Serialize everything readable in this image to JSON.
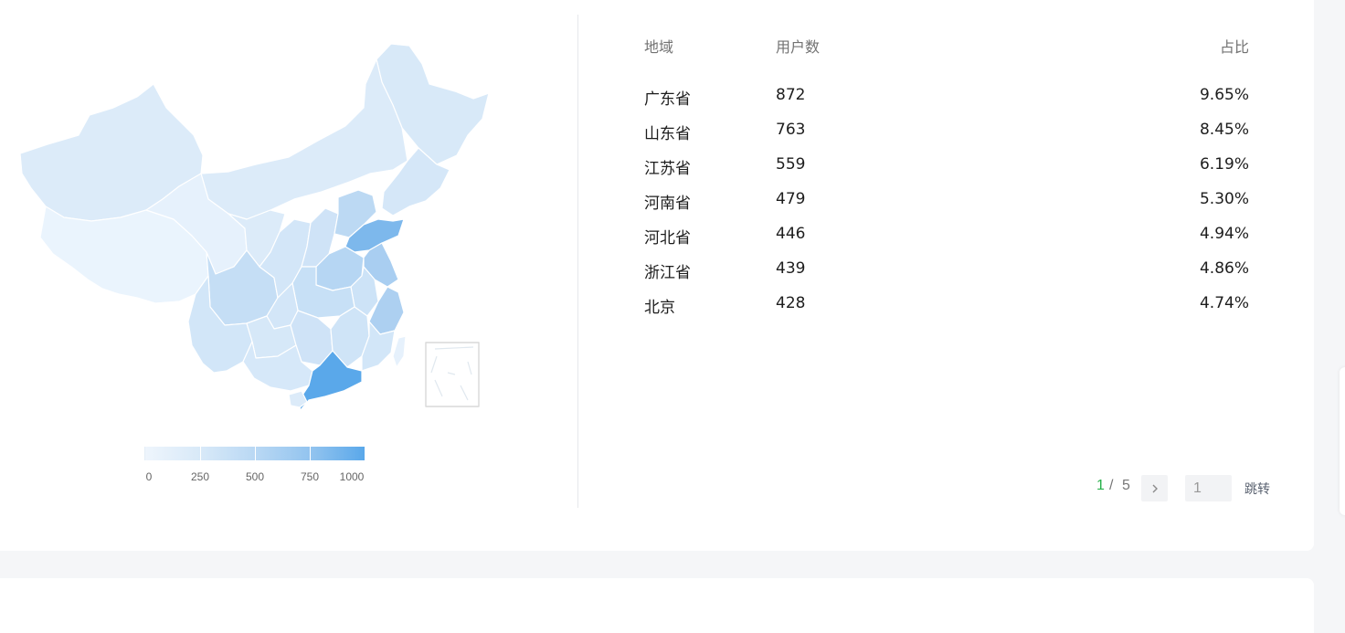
{
  "colors": {
    "accent_green": "#27b04a",
    "map_low": "#e8f3fc",
    "map_high": "#5aa8ea",
    "page_bg": "#f5f6f8"
  },
  "map": {
    "legend": {
      "ticks": [
        "0",
        "250",
        "500",
        "750",
        "1000"
      ],
      "max": 1000
    }
  },
  "table": {
    "headers": {
      "region": "地域",
      "users": "用户数",
      "ratio": "占比"
    },
    "rows": [
      {
        "region": "广东省",
        "users": "872",
        "ratio": "9.65%"
      },
      {
        "region": "山东省",
        "users": "763",
        "ratio": "8.45%"
      },
      {
        "region": "江苏省",
        "users": "559",
        "ratio": "6.19%"
      },
      {
        "region": "河南省",
        "users": "479",
        "ratio": "5.30%"
      },
      {
        "region": "河北省",
        "users": "446",
        "ratio": "4.94%"
      },
      {
        "region": "浙江省",
        "users": "439",
        "ratio": "4.86%"
      },
      {
        "region": "北京",
        "users": "428",
        "ratio": "4.74%"
      }
    ]
  },
  "pagination": {
    "current": "1",
    "separator": "/",
    "total": "5",
    "next_icon": "chevron-right-icon",
    "jump_input_value": "1",
    "jump_label": "跳转"
  }
}
